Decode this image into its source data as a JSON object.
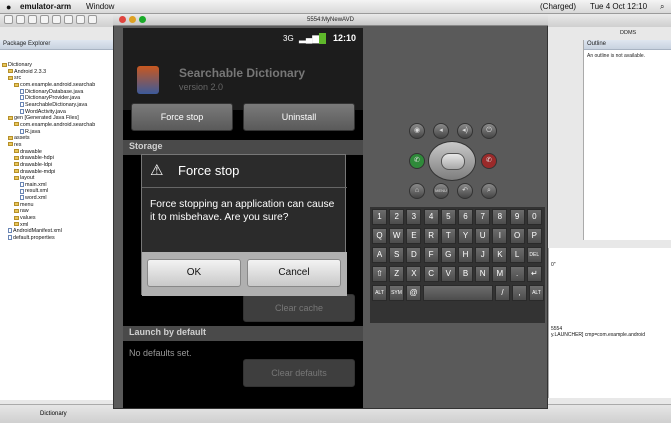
{
  "menubar": {
    "apple": "",
    "app": "emulator-arm",
    "window": "Window",
    "charge": "(Charged)",
    "clock": "Tue 4 Oct  12:10"
  },
  "emulator": {
    "title": "5554:MyNewAVD"
  },
  "eclipse": {
    "package_explorer": "Package Explorer",
    "tree": [
      "Dictionary",
      "Android 2.3.3",
      "src",
      "com.example.android.searchab",
      "DictionaryDatabase.java",
      "DictionaryProvider.java",
      "SearchableDictionary.java",
      "WordActivity.java",
      "gen [Generated Java Files]",
      "com.example.android.searchab",
      "R.java",
      "assets",
      "res",
      "drawable",
      "drawable-hdpi",
      "drawable-ldpi",
      "drawable-mdpi",
      "layout",
      "main.xml",
      "result.xml",
      "word.xml",
      "menu",
      "raw",
      "values",
      "xml",
      "AndroidManifest.xml",
      "default.properties"
    ],
    "outline_title": "Outline",
    "outline_msg": "An outline is not available.",
    "ddms": "DDMS",
    "console_lines": [
      "0\"",
      "5554",
      "y.LAUNCHER] cmp=com.example.android"
    ],
    "status_project": "Dictionary"
  },
  "device": {
    "time": "12:10",
    "app_name": "Searchable Dictionary",
    "app_version": "version 2.0",
    "force_stop": "Force stop",
    "uninstall": "Uninstall",
    "storage": "Storage",
    "clear_cache": "Clear cache",
    "launch_default": "Launch by default",
    "no_defaults": "No defaults set.",
    "clear_defaults": "Clear defaults",
    "dialog": {
      "title": "Force stop",
      "message": "Force stopping an application can cause it to misbehave. Are you sure?",
      "ok": "OK",
      "cancel": "Cancel"
    }
  },
  "keyboard": {
    "row1": [
      "1",
      "2",
      "3",
      "4",
      "5",
      "6",
      "7",
      "8",
      "9",
      "0"
    ],
    "row2": [
      "Q",
      "W",
      "E",
      "R",
      "T",
      "Y",
      "U",
      "I",
      "O",
      "P"
    ],
    "row3": [
      "A",
      "S",
      "D",
      "F",
      "G",
      "H",
      "J",
      "K",
      "L",
      "DEL"
    ],
    "row4": [
      "⇧",
      "Z",
      "X",
      "C",
      "V",
      "B",
      "N",
      "M",
      ".",
      "↵"
    ],
    "row5": [
      "ALT",
      "SYM",
      "@",
      "",
      "/",
      ",",
      "ALT"
    ]
  }
}
